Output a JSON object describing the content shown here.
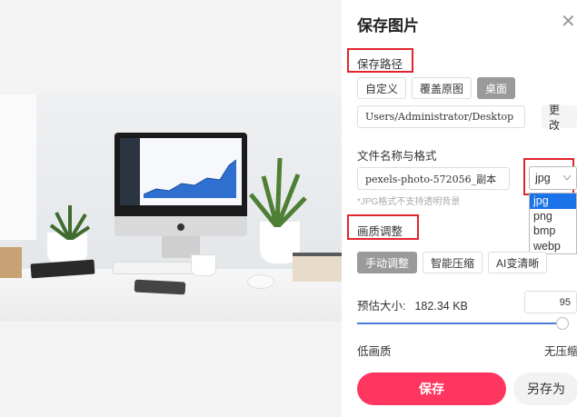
{
  "dialog": {
    "title": "保存图片",
    "close_glyph": "✕"
  },
  "save_path": {
    "label": "保存路径",
    "options": [
      "自定义",
      "覆盖原图",
      "桌面"
    ],
    "active_option": "桌面",
    "path_value": "Users/Administrator/Desktop",
    "change_label": "更改"
  },
  "file": {
    "label": "文件名称与格式",
    "name_value": "pexels-photo-572056_副本",
    "format_selected": "jpg",
    "format_options": [
      "jpg",
      "png",
      "bmp",
      "webp"
    ],
    "hint": "*JPG格式不支持透明背景"
  },
  "quality": {
    "label": "画质调整",
    "modes": [
      "手动调整",
      "智能压缩",
      "AI变清晰"
    ],
    "active_mode": "手动调整",
    "size_label": "预估大小:",
    "size_value": "182.34 KB",
    "quality_value": "95",
    "quality_level": 0.95,
    "low_label": "低画质",
    "high_label": "无压缩"
  },
  "actions": {
    "save_label": "保存",
    "save_as_label": "另存为"
  },
  "colors": {
    "accent": "#ff3660",
    "highlight_box": "#e0262b",
    "slider": "#4a7cd9",
    "dropdown_selected": "#1a73e8"
  },
  "icons": {
    "close": "close-icon",
    "dropdown": "chevron-down-icon",
    "monitor_logo": "apple-logo-icon"
  }
}
